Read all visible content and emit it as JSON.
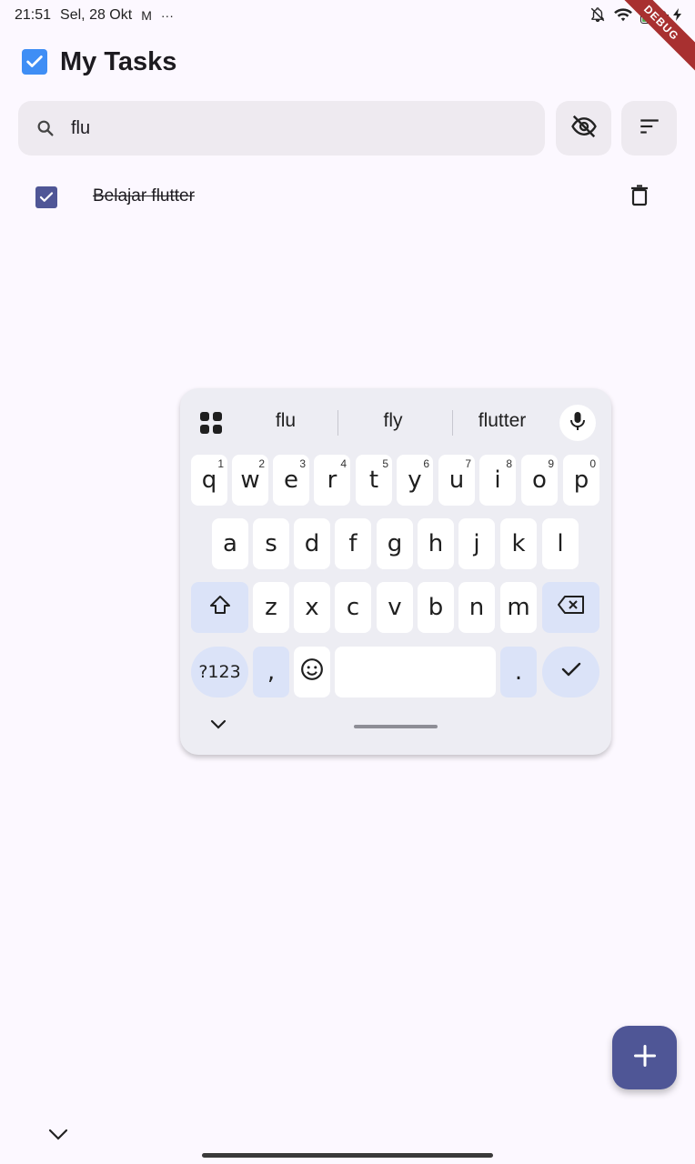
{
  "status_bar": {
    "time": "21:51",
    "date": "Sel, 28 Okt",
    "notification_icons": [
      "gmail-icon",
      "more-dots-icon"
    ],
    "mail_glyph": "M",
    "more_glyph": "···",
    "battery_level": "92",
    "debug_banner": "DEBUG"
  },
  "app_bar": {
    "title": "My Tasks",
    "logo_icon": "checkbox-checked-icon",
    "logo_color": "#3f8ef5"
  },
  "search": {
    "value": "flu",
    "icon": "search-icon",
    "visibility_toggle_icon": "visibility-off-icon",
    "sort_icon": "sort-icon"
  },
  "tasks": [
    {
      "label": "Belajar flutter",
      "completed": true,
      "delete_icon": "trash-icon"
    }
  ],
  "keyboard": {
    "suggestions": [
      "flu",
      "fly",
      "flutter"
    ],
    "row1": [
      {
        "key": "q",
        "hint": "1"
      },
      {
        "key": "w",
        "hint": "2"
      },
      {
        "key": "e",
        "hint": "3"
      },
      {
        "key": "r",
        "hint": "4"
      },
      {
        "key": "t",
        "hint": "5"
      },
      {
        "key": "y",
        "hint": "6"
      },
      {
        "key": "u",
        "hint": "7"
      },
      {
        "key": "i",
        "hint": "8"
      },
      {
        "key": "o",
        "hint": "9"
      },
      {
        "key": "p",
        "hint": "0"
      }
    ],
    "row2": [
      "a",
      "s",
      "d",
      "f",
      "g",
      "h",
      "j",
      "k",
      "l"
    ],
    "row3": [
      "z",
      "x",
      "c",
      "v",
      "b",
      "n",
      "m"
    ],
    "symbols_label": "?123",
    "comma_label": ",",
    "period_label": "."
  },
  "colors": {
    "primary": "#4f5696",
    "background": "#fcf8ff",
    "surface_variant": "#eeeaf0"
  }
}
